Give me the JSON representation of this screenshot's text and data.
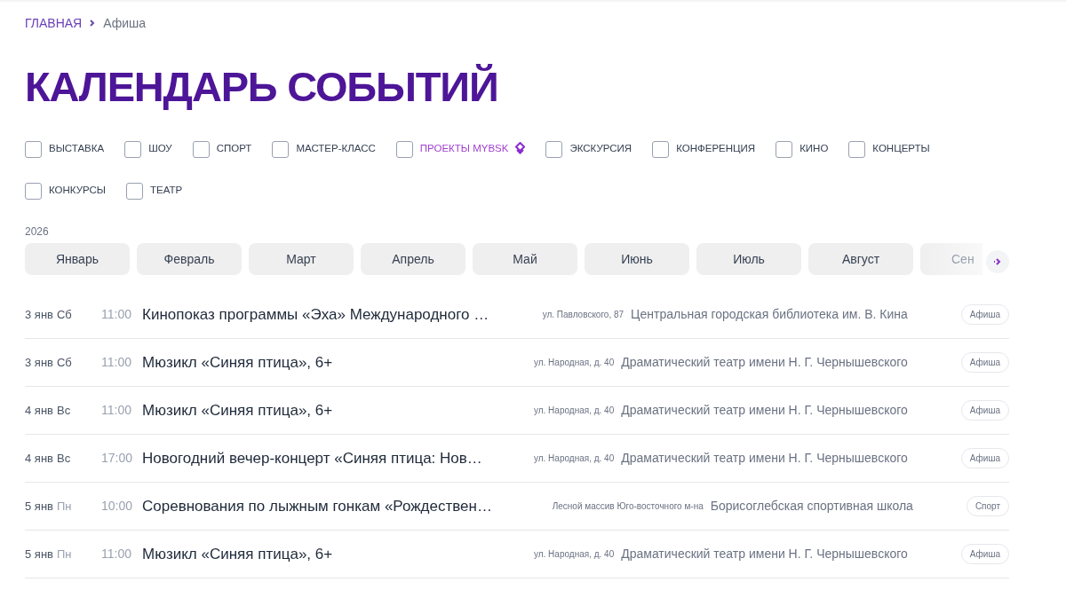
{
  "breadcrumbs": [
    {
      "label": "ГЛАВНАЯ",
      "current": false
    },
    {
      "label": "Афиша",
      "current": true
    }
  ],
  "title": "КАЛЕНДАРЬ СОБЫТИЙ",
  "filters": [
    {
      "label": "ВЫСТАВКА",
      "checked": false,
      "kind": "plain"
    },
    {
      "label": "ШОУ",
      "checked": false,
      "kind": "plain"
    },
    {
      "label": "СПОРТ",
      "checked": false,
      "kind": "plain"
    },
    {
      "label": "МАСТЕР-КЛАСС",
      "checked": false,
      "kind": "plain"
    },
    {
      "label": "ПРОЕКТЫ MYBSK",
      "checked": false,
      "kind": "special"
    },
    {
      "label": "ЭКСКУРСИЯ",
      "checked": false,
      "kind": "plain"
    },
    {
      "label": "КОНФЕРЕНЦИЯ",
      "checked": false,
      "kind": "plain"
    },
    {
      "label": "КИНО",
      "checked": false,
      "kind": "plain"
    },
    {
      "label": "КОНЦЕРТЫ",
      "checked": false,
      "kind": "plain"
    },
    {
      "label": "КОНКУРСЫ",
      "checked": false,
      "kind": "plain"
    },
    {
      "label": "ТЕАТР",
      "checked": false,
      "kind": "plain"
    }
  ],
  "year": "2026",
  "months": [
    {
      "label": "Январь",
      "faded": false
    },
    {
      "label": "Февраль",
      "faded": false
    },
    {
      "label": "Март",
      "faded": false
    },
    {
      "label": "Апрель",
      "faded": false
    },
    {
      "label": "Май",
      "faded": false
    },
    {
      "label": "Июнь",
      "faded": false
    },
    {
      "label": "Июль",
      "faded": false
    },
    {
      "label": "Август",
      "faded": false
    },
    {
      "label": "Сен",
      "faded": true
    }
  ],
  "events": [
    {
      "date": "3 янв",
      "weekday": "Сб",
      "weekend": true,
      "time": "11:00",
      "title": "Кинопоказ программы «Эха» Международного …",
      "address": "ул. Павловского, 87",
      "venue": "Центральная городская библиотека им. В. Кина",
      "tag": "Афиша"
    },
    {
      "date": "3 янв",
      "weekday": "Сб",
      "weekend": true,
      "time": "11:00",
      "title": "Мюзикл «Синяя птица», 6+",
      "address": "ул. Народная, д. 40",
      "venue": "Драматический театр имени Н. Г. Чернышевского",
      "tag": "Афиша"
    },
    {
      "date": "4 янв",
      "weekday": "Вс",
      "weekend": true,
      "time": "11:00",
      "title": "Мюзикл «Синяя птица», 6+",
      "address": "ул. Народная, д. 40",
      "venue": "Драматический театр имени Н. Г. Чернышевского",
      "tag": "Афиша"
    },
    {
      "date": "4 янв",
      "weekday": "Вс",
      "weekend": true,
      "time": "17:00",
      "title": "Новогодний вечер-концерт «Синяя птица: Нов…",
      "address": "ул. Народная, д. 40",
      "venue": "Драматический театр имени Н. Г. Чернышевского",
      "tag": "Афиша"
    },
    {
      "date": "5 янв",
      "weekday": "Пн",
      "weekend": false,
      "time": "10:00",
      "title": "Соревнования по лыжным гонкам «Рождествен…",
      "address": "Лесной массив Юго-восточного м-на",
      "venue": "Борисоглебская спортивная школа",
      "tag": "Спорт"
    },
    {
      "date": "5 янв",
      "weekday": "Пн",
      "weekend": false,
      "time": "11:00",
      "title": "Мюзикл «Синяя птица», 6+",
      "address": "ул. Народная, д. 40",
      "venue": "Драматический театр имени Н. Г. Чернышевского",
      "tag": "Афиша"
    }
  ]
}
